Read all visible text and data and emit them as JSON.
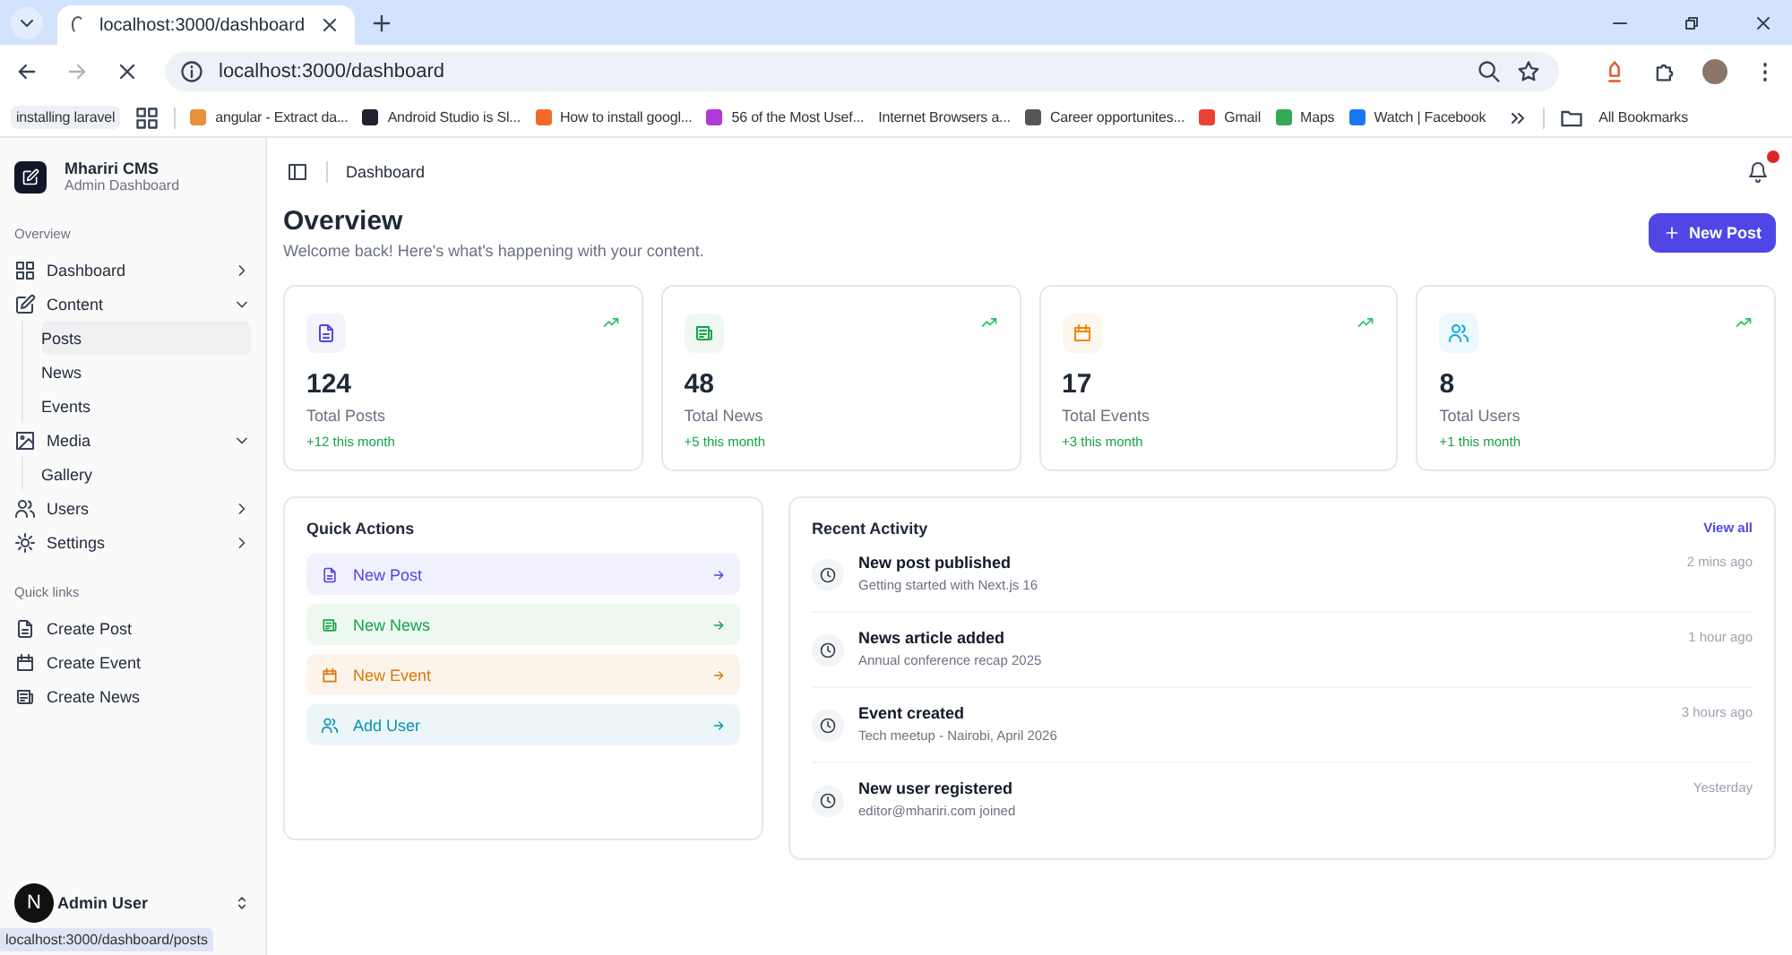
{
  "browser": {
    "tab": {
      "title": "localhost:3000/dashboard"
    },
    "address": "localhost:3000/dashboard",
    "bookmarks": [
      {
        "label": "installing laravel",
        "kind": "chip"
      },
      {
        "label": "angular - Extract da...",
        "color": "#e8903a"
      },
      {
        "label": "Android Studio is Sl...",
        "color": "#1f2033"
      },
      {
        "label": "How to install googl...",
        "color": "#f26b2c"
      },
      {
        "label": "56 of the Most Usef...",
        "color": "#b03ad9"
      },
      {
        "label": "Internet Browsers a..."
      },
      {
        "label": "Career opportunites...",
        "color": "#555555"
      },
      {
        "label": "Gmail",
        "color": "#ea4335"
      },
      {
        "label": "Maps",
        "color": "#34a853"
      },
      {
        "label": "Watch | Facebook",
        "color": "#1877f2"
      }
    ],
    "all_bookmarks": "All Bookmarks"
  },
  "sidebar": {
    "brand": {
      "name": "Mhariri CMS",
      "subtitle": "Admin Dashboard"
    },
    "nav_title": "Overview",
    "nav": [
      {
        "label": "Dashboard",
        "expanded": false
      },
      {
        "label": "Content",
        "expanded": true,
        "children": [
          {
            "label": "Posts",
            "selected": true
          },
          {
            "label": "News",
            "selected": false
          },
          {
            "label": "Events",
            "selected": false
          }
        ]
      },
      {
        "label": "Media",
        "expanded": true,
        "children": [
          {
            "label": "Gallery",
            "selected": false
          }
        ]
      },
      {
        "label": "Users",
        "expanded": false
      },
      {
        "label": "Settings",
        "expanded": false
      }
    ],
    "links_title": "Quick links",
    "links": [
      {
        "label": "Create Post"
      },
      {
        "label": "Create Event"
      },
      {
        "label": "Create News"
      }
    ],
    "user": {
      "name": "Admin User"
    },
    "dev_badge": "N"
  },
  "header": {
    "breadcrumb": "Dashboard",
    "unread": true
  },
  "page": {
    "title": "Overview",
    "subtitle": "Welcome back! Here's what's happening with your content.",
    "new_button": "New Post"
  },
  "stats": [
    {
      "value": "124",
      "label": "Total Posts",
      "delta": "+12 this month",
      "color": "#4f46e5"
    },
    {
      "value": "48",
      "label": "Total News",
      "delta": "+5 this month",
      "color": "#16a34a"
    },
    {
      "value": "17",
      "label": "Total Events",
      "delta": "+3 this month",
      "color": "#ea8a0c"
    },
    {
      "value": "8",
      "label": "Total Users",
      "delta": "+1 this month",
      "color": "#0ea5e9"
    }
  ],
  "quick_actions": {
    "title": "Quick Actions",
    "items": [
      {
        "label": "New Post",
        "color": "#4f46e5"
      },
      {
        "label": "New News",
        "color": "#16a34a"
      },
      {
        "label": "New Event",
        "color": "#d97706"
      },
      {
        "label": "Add User",
        "color": "#0891b2"
      }
    ]
  },
  "activity": {
    "title": "Recent Activity",
    "view_all": "View all",
    "items": [
      {
        "title": "New post published",
        "detail": "Getting started with Next.js 16",
        "time": "2 mins ago"
      },
      {
        "title": "News article added",
        "detail": "Annual conference recap 2025",
        "time": "1 hour ago"
      },
      {
        "title": "Event created",
        "detail": "Tech meetup - Nairobi, April 2026",
        "time": "3 hours ago"
      },
      {
        "title": "New user registered",
        "detail": "editor@mhariri.com joined",
        "time": "Yesterday"
      }
    ]
  },
  "status_url": "localhost:3000/dashboard/posts"
}
